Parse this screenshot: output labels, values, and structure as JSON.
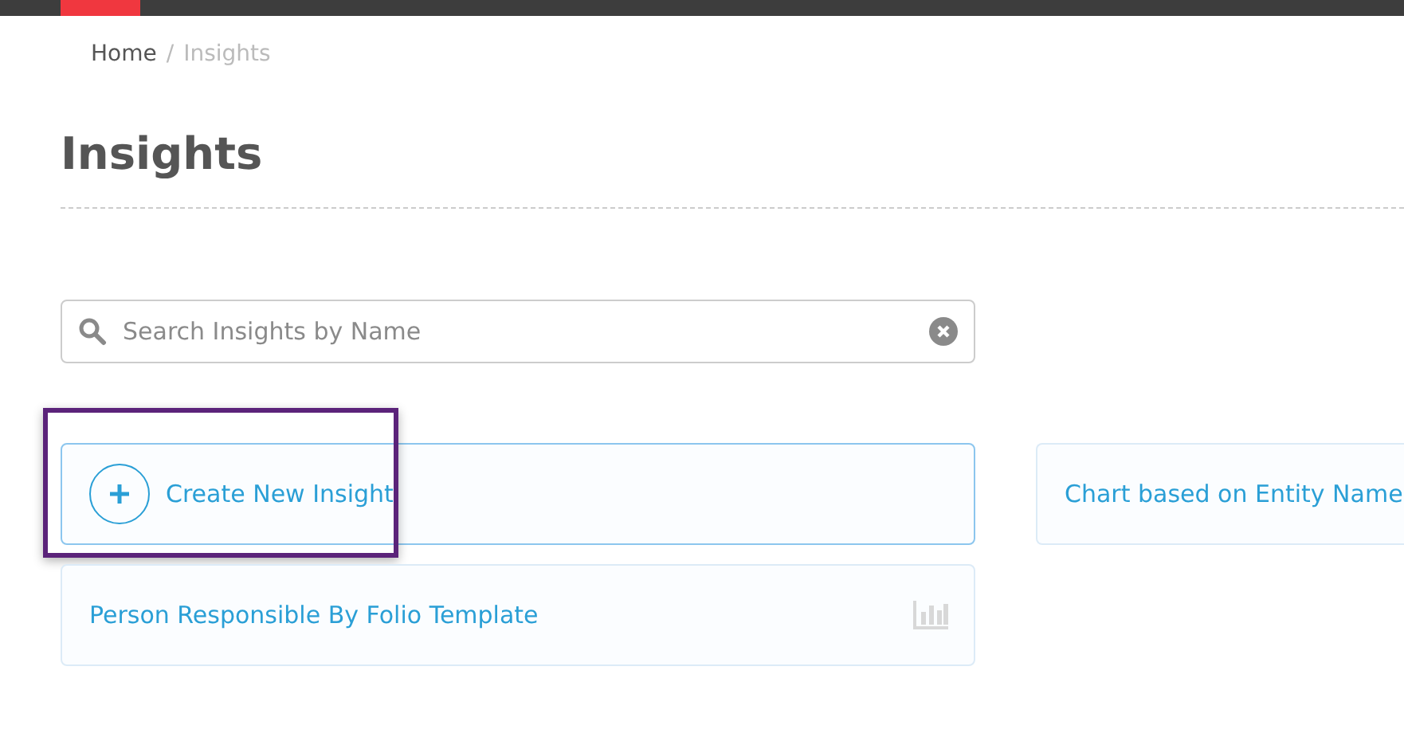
{
  "breadcrumb": [
    {
      "label": "Home",
      "current": false
    },
    {
      "label": "Insights",
      "current": true
    }
  ],
  "breadcrumb_separator": "/",
  "title": "Insights",
  "search": {
    "placeholder": "Search Insights by Name"
  },
  "cards": [
    {
      "kind": "create",
      "label": "Create New Insight",
      "highlighted": true
    },
    {
      "kind": "chart",
      "label": "Chart based on Entity Name",
      "highlighted": false
    },
    {
      "kind": "chart",
      "label": "Person Responsible By Folio Template",
      "highlighted": false
    }
  ]
}
